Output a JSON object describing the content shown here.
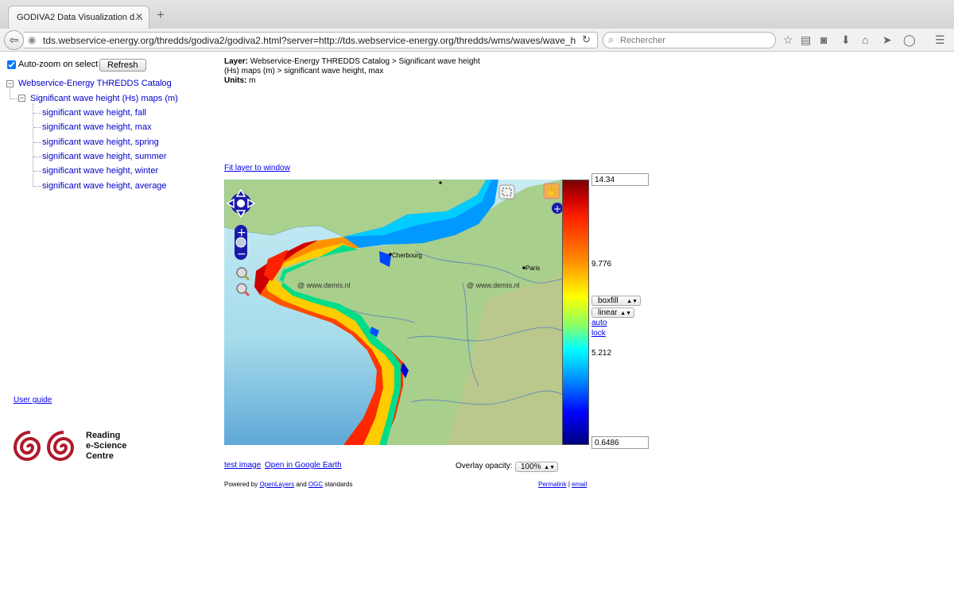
{
  "browser": {
    "tab_title": "GODIVA2 Data Visualization d…",
    "tab_close": "✕",
    "new_tab": "+",
    "url": "tds.webservice-energy.org/thredds/godiva2/godiva2.html?server=http://tds.webservice-energy.org/thredds/wms/waves/wave_hs_",
    "search_placeholder": "Rechercher"
  },
  "sidebar": {
    "autozoom_label": "Auto-zoom on select",
    "autozoom_checked": true,
    "refresh_label": "Refresh",
    "tree": {
      "catalog": "Webservice-Energy THREDDS Catalog",
      "dataset": "Significant wave height (Hs) maps (m)",
      "layers": [
        "significant wave height, fall",
        "significant wave height, max",
        "significant wave height, spring",
        "significant wave height, summer",
        "significant wave height, winter",
        "significant wave height, average"
      ]
    },
    "user_guide": "User guide",
    "logo_text": [
      "Reading",
      "e-Science",
      "Centre"
    ]
  },
  "layer_info": {
    "layer_label": "Layer:",
    "layer_value_line1": "Webservice-Energy THREDDS Catalog > Significant wave height",
    "layer_value_line2": "(Hs) maps (m) > significant wave height, max",
    "units_label": "Units:",
    "units_value": "m"
  },
  "fit_layer": "Fit layer to window",
  "map": {
    "labels": [
      "Cherbourg",
      "Paris",
      "@ www.demis.nl",
      "@ www.demis.nl"
    ],
    "colors": {
      "sea": "#9bd8ea",
      "land": "#a9cf8c",
      "high": "#cc0000",
      "low": "#0000ff"
    }
  },
  "colorbar": {
    "max": "14.34",
    "mid": "9.776",
    "low": "5.212",
    "min": "0.6486",
    "style_select": "boxfill",
    "scale_select": "linear",
    "auto": "auto",
    "lock": "lock"
  },
  "footer": {
    "test_image": "test image",
    "google_earth": "Open in Google Earth",
    "opacity_label": "Overlay opacity:",
    "opacity_value": "100%",
    "powered_prefix": "Powered by",
    "openlayers": "OpenLayers",
    "and": "and",
    "ogc": "OGC",
    "standards": "standards",
    "permalink": "Permalink",
    "sep": "|",
    "email": "email"
  }
}
